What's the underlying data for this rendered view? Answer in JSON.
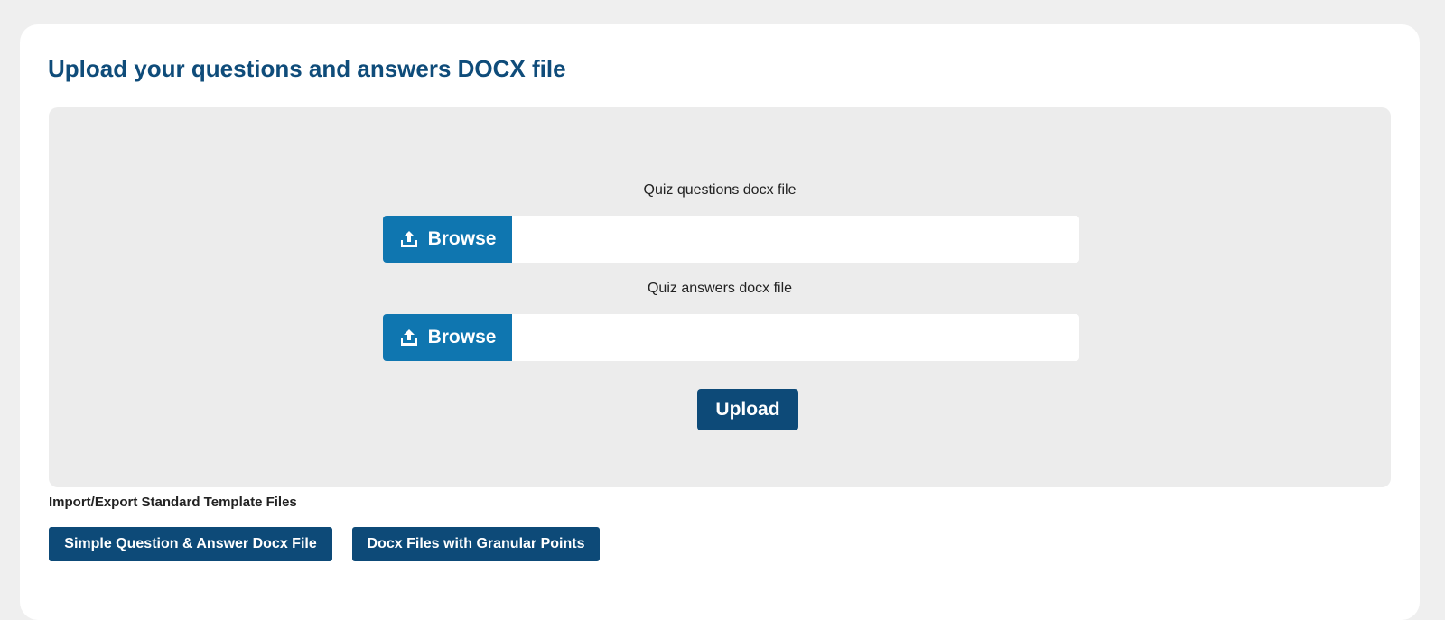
{
  "card": {
    "title": "Upload your questions and answers DOCX file"
  },
  "upload": {
    "questions": {
      "label": "Quiz questions docx file",
      "browse_label": "Browse",
      "file_name": ""
    },
    "answers": {
      "label": "Quiz answers docx file",
      "browse_label": "Browse",
      "file_name": ""
    },
    "upload_label": "Upload"
  },
  "templates": {
    "heading": "Import/Export Standard Template Files",
    "buttons": [
      {
        "label": "Simple Question & Answer Docx File"
      },
      {
        "label": "Docx Files with Granular Points"
      }
    ]
  },
  "icons": {
    "browse": "upload-tray-icon"
  },
  "colors": {
    "page_background": "#efefef",
    "card_background": "#ffffff",
    "title": "#0f4c7a",
    "panel_background": "#ececec",
    "browse_button": "#0f76b0",
    "primary_button": "#0d4a78"
  }
}
